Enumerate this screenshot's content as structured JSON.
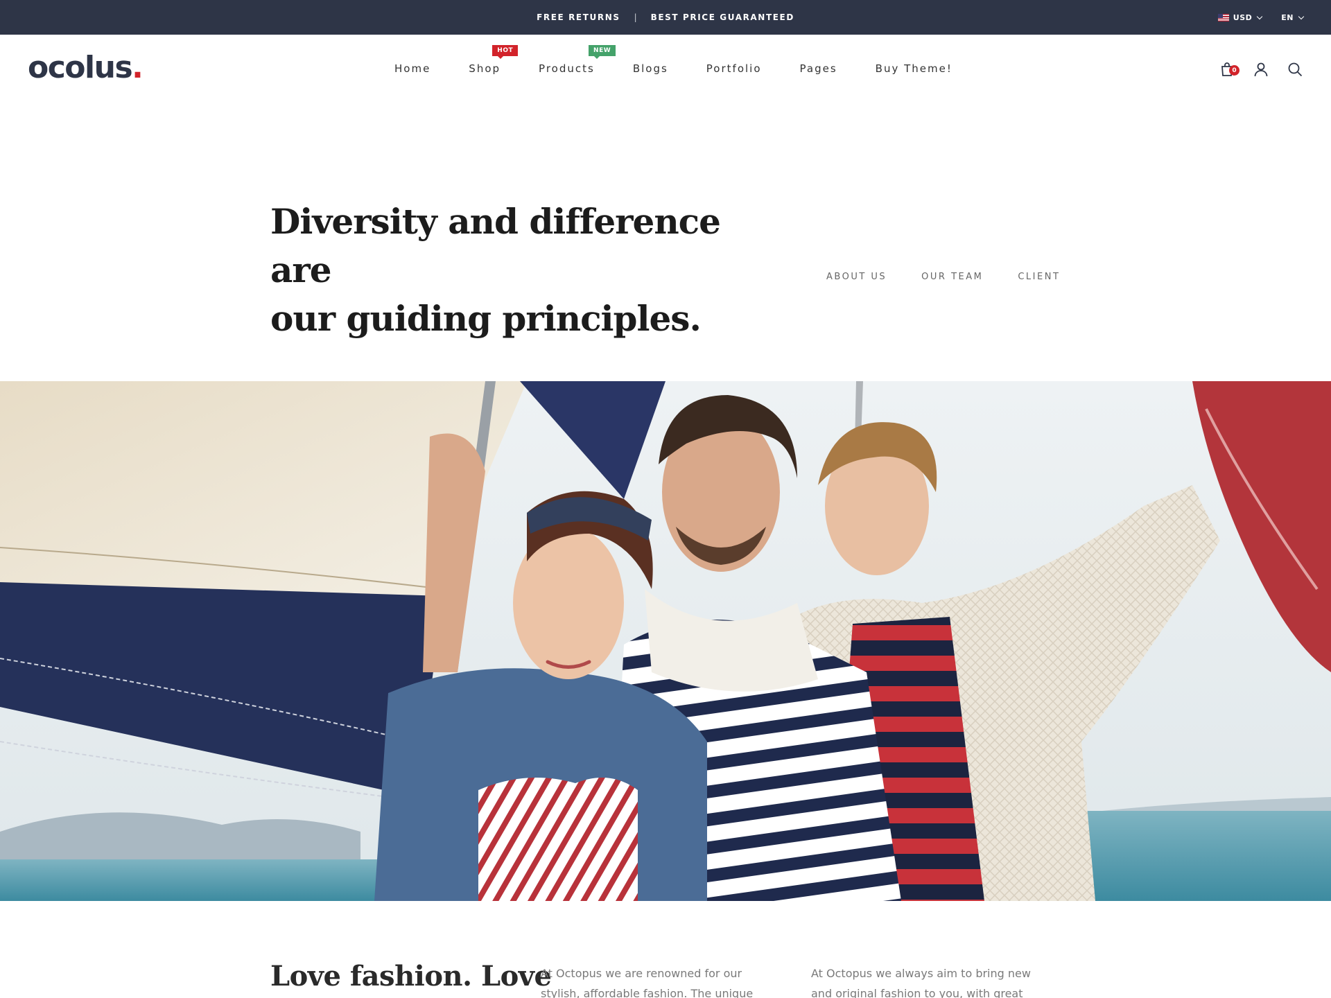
{
  "topbar": {
    "promo_1": "FREE RETURNS",
    "separator": "|",
    "promo_2": "BEST PRICE GUARANTEED",
    "currency": "USD",
    "currency_flag": "us-flag-icon",
    "language": "EN"
  },
  "header": {
    "logo_text": "ocolus",
    "logo_dot": ".",
    "nav": [
      {
        "label": "Home"
      },
      {
        "label": "Shop",
        "badge": "HOT"
      },
      {
        "label": "Products",
        "badge": "NEW"
      },
      {
        "label": "Blogs"
      },
      {
        "label": "Portfolio"
      },
      {
        "label": "Pages"
      },
      {
        "label": "Buy Theme!"
      }
    ],
    "cart_count": "0",
    "icons": [
      "shopping-bag-icon",
      "user-icon",
      "search-icon"
    ]
  },
  "hero": {
    "title_line_1": "Diversity and difference are",
    "title_line_2": "our guiding principles.",
    "subnav": [
      "ABOUT US",
      "OUR TEAM",
      "CLIENT"
    ]
  },
  "content": {
    "heading": "Love fashion. Love",
    "col_1": "At Octopus we are renowned for our stylish, affordable fashion. The unique touches we",
    "col_2": "At Octopus we always aim to bring new and original fashion to you, with great design at"
  },
  "colors": {
    "topbar_bg": "#2e3547",
    "accent_red": "#d2232a",
    "badge_green": "#44a26a",
    "logo": "#2e3547"
  }
}
